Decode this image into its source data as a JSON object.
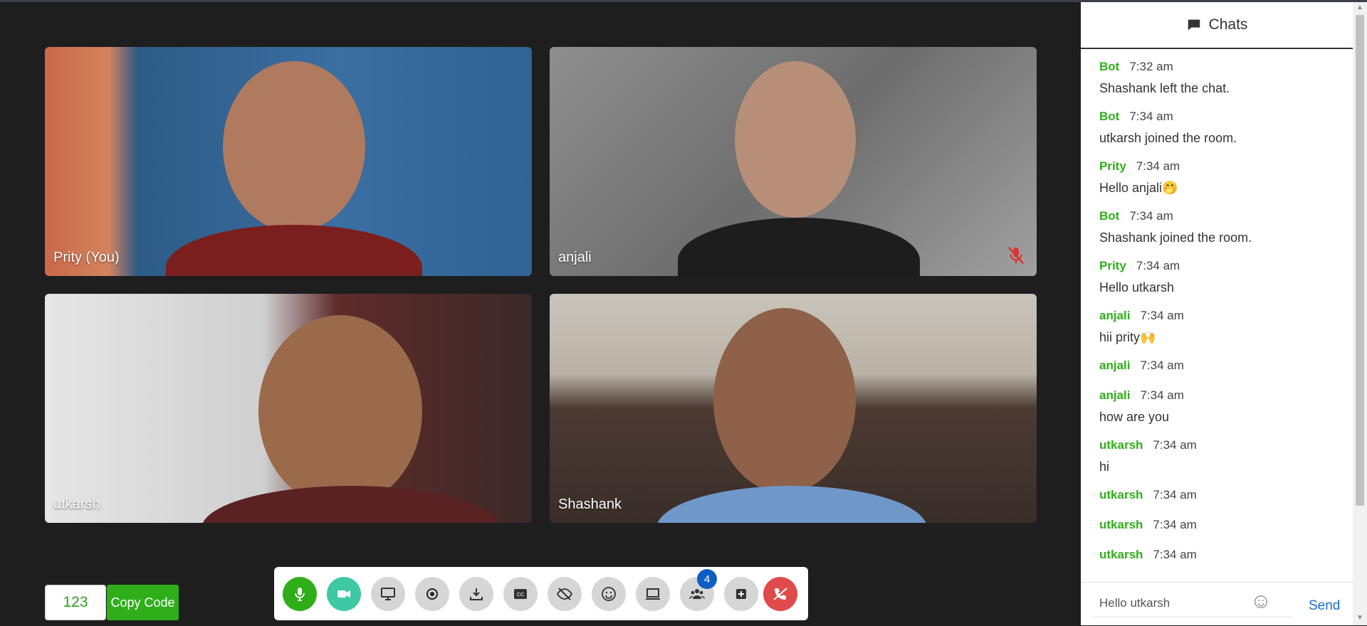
{
  "room": {
    "code": "123",
    "copy_label": "Copy Code"
  },
  "participants": [
    {
      "name": "Prity (You)",
      "muted": false
    },
    {
      "name": "anjali",
      "muted": true
    },
    {
      "name": "utkarsh",
      "muted": false
    },
    {
      "name": "Shashank",
      "muted": false
    }
  ],
  "toolbar": {
    "buttons": [
      {
        "icon": "microphone-icon",
        "state": "on"
      },
      {
        "icon": "video-camera-icon",
        "state": "on"
      },
      {
        "icon": "screen-share-icon"
      },
      {
        "icon": "record-icon"
      },
      {
        "icon": "download-icon"
      },
      {
        "icon": "closed-captions-icon"
      },
      {
        "icon": "hide-self-view-icon"
      },
      {
        "icon": "emoji-icon"
      },
      {
        "icon": "whiteboard-icon"
      },
      {
        "icon": "participants-icon"
      },
      {
        "icon": "add-icon"
      },
      {
        "icon": "end-call-icon"
      }
    ],
    "participant_count": "4"
  },
  "chat": {
    "title": "Chats",
    "messages": [
      {
        "sender": "Bot",
        "time": "7:32 am",
        "text": "Shashank left the chat."
      },
      {
        "sender": "Bot",
        "time": "7:34 am",
        "text": "utkarsh joined the room."
      },
      {
        "sender": "Prity",
        "time": "7:34 am",
        "text": "Hello anjali🤭"
      },
      {
        "sender": "Bot",
        "time": "7:34 am",
        "text": "Shashank joined the room."
      },
      {
        "sender": "Prity",
        "time": "7:34 am",
        "text": "Hello utkarsh"
      },
      {
        "sender": "anjali",
        "time": "7:34 am",
        "text": "hii prity🙌"
      },
      {
        "sender": "anjali",
        "time": "7:34 am",
        "text": ""
      },
      {
        "sender": "anjali",
        "time": "7:34 am",
        "text": "how are you"
      },
      {
        "sender": "utkarsh",
        "time": "7:34 am",
        "text": "hi"
      },
      {
        "sender": "utkarsh",
        "time": "7:34 am",
        "text": ""
      },
      {
        "sender": "utkarsh",
        "time": "7:34 am",
        "text": ""
      },
      {
        "sender": "utkarsh",
        "time": "7:34 am",
        "text": ""
      }
    ],
    "input_value": "Hello utkarsh",
    "send_label": "Send"
  },
  "colors": {
    "accent_green": "#2fae1a",
    "end_call_red": "#e04a4a",
    "badge_blue": "#0d5ec4",
    "link_blue": "#1c6bd1"
  }
}
